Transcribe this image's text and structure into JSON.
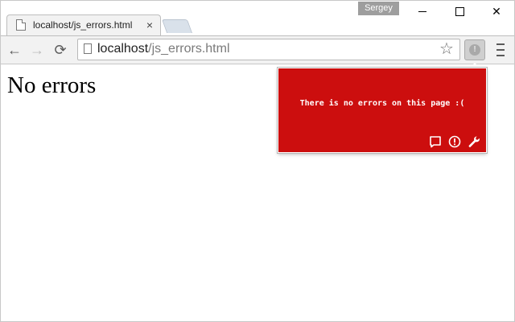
{
  "window": {
    "user_label": "Sergey",
    "minimize_symbol": "—",
    "close_symbol": "✕"
  },
  "tab": {
    "title": "localhost/js_errors.html",
    "close_symbol": "×"
  },
  "toolbar": {
    "back_symbol": "←",
    "forward_symbol": "→",
    "reload_symbol": "⟳",
    "url_host": "localhost",
    "url_path": "/js_errors.html",
    "bookmark_symbol": "☆",
    "extension_symbol": "!"
  },
  "page": {
    "heading": "No errors"
  },
  "popup": {
    "message": "There is no errors on this page :(",
    "icons": [
      "comment-icon",
      "alert-icon",
      "wrench-icon"
    ],
    "background_color": "#cc0e0e"
  }
}
